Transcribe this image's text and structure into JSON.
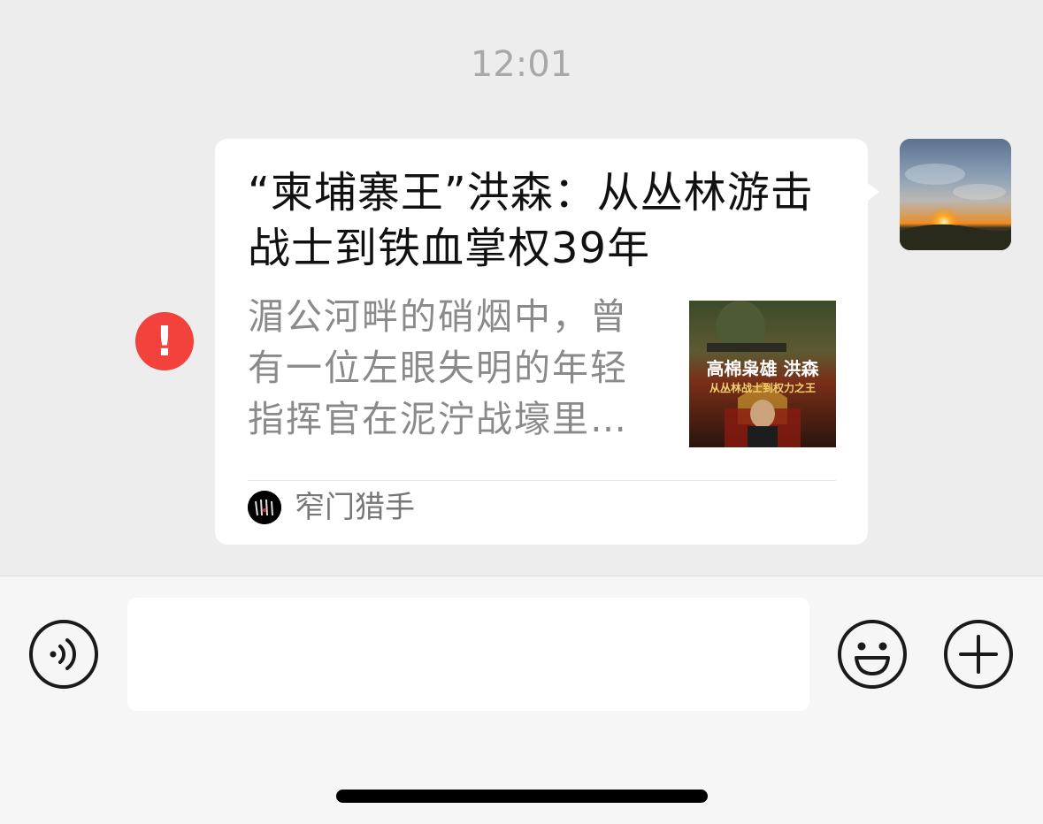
{
  "timestamp": "12:01",
  "message": {
    "error_mark": "!",
    "article": {
      "title": "“柬埔寨王”洪森：从丛林游击战士到铁血掌权39年",
      "description": "湄公河畔的硝烟中，曾有一位左眼失明的年轻指挥官在泥泞战壕里…",
      "thumbnail": {
        "title_text": "高棉枭雄 洪森",
        "subtitle_text": "从丛林战士到权力之王"
      },
      "source_name": "窄门猎手"
    }
  },
  "input_bar": {
    "input_value": "",
    "icons": [
      "voice-icon",
      "emoji-icon",
      "plus-icon"
    ]
  },
  "colors": {
    "chat_background": "#ededed",
    "bubble": "#ffffff",
    "error": "#f2423b",
    "title": "#111111",
    "description": "#8a8a8a"
  }
}
